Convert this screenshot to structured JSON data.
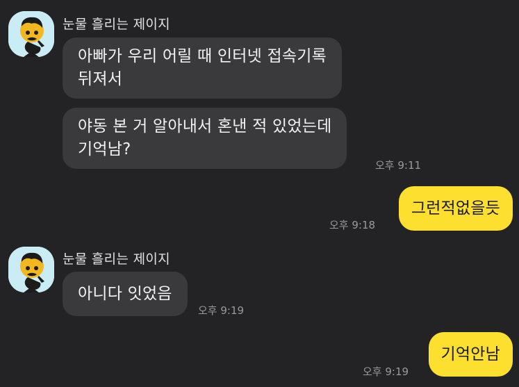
{
  "colors": {
    "background": "#232325",
    "incoming_bubble": "#3a3a3c",
    "outgoing_bubble": "#fde02f",
    "timestamp": "#9a9a9a",
    "avatar_bg": "#c9ecf5"
  },
  "messages": {
    "group1": {
      "sender": "눈물 흘리는 제이지",
      "avatar_icon": "crying-character-icon",
      "msg1": {
        "line1": "아빠가 우리 어릴 때 인터넷 접속기록",
        "line2": "뒤져서"
      },
      "msg2": {
        "line1": "야동 본 거 알아내서 혼낸 적 있었는데",
        "line2": "기억남?"
      },
      "time": "오후 9:11"
    },
    "reply1": {
      "text": "그런적없을듯",
      "time": "오후 9:18"
    },
    "group2": {
      "sender": "눈물 흘리는 제이지",
      "avatar_icon": "crying-character-icon",
      "msg1": {
        "text": "아니다 잇었음"
      },
      "time": "오후 9:19"
    },
    "reply2": {
      "text": "기억안남",
      "time": "오후 9:19"
    }
  }
}
